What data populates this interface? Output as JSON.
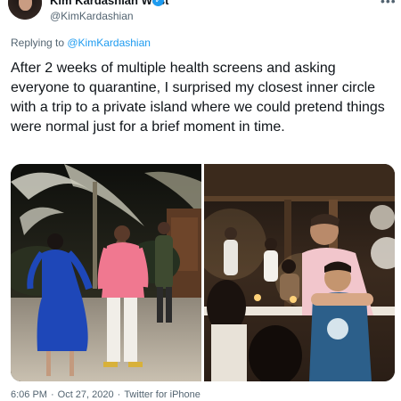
{
  "author": {
    "display_name": "Kim Kardashian West",
    "handle": "@KimKardashian",
    "verified_glyph": "✓"
  },
  "reply": {
    "prefix": "Replying to ",
    "mention": "@KimKardashian"
  },
  "tweet": {
    "text": "After 2 weeks of multiple health screens and asking everyone to quarantine, I surprised my closest inner circle with a trip to a private island where we could pretend things were normal just for a brief moment in time."
  },
  "menu": {
    "more_glyph": "•••"
  },
  "meta": {
    "time": "6:06 PM",
    "separator": "·",
    "date": "Oct 27, 2020",
    "separator2": "·",
    "source": "Twitter for iPhone"
  },
  "icons": {
    "verified": "verified-badge-icon",
    "more": "more-options-icon"
  },
  "colors": {
    "accent": "#1d9bf0",
    "secondary_text": "#536471",
    "primary_text": "#0f1419"
  }
}
